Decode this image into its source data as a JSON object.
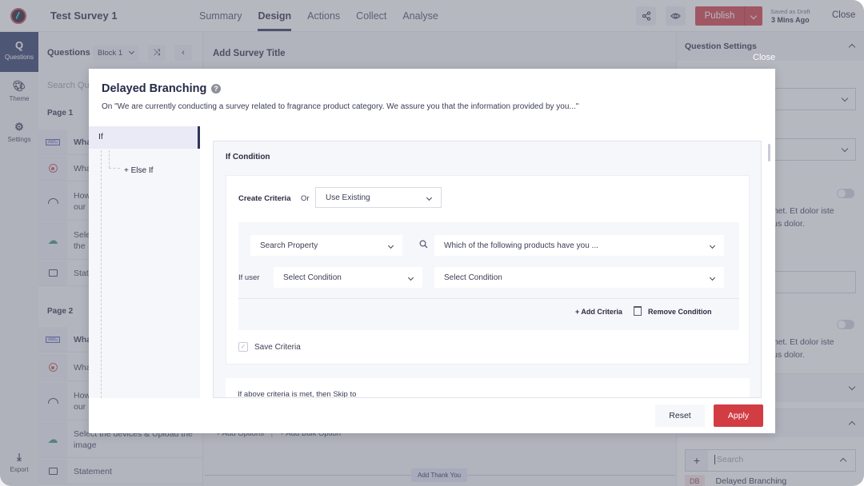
{
  "header": {
    "survey_title": "Test Survey 1",
    "tabs": [
      {
        "label": "Summary",
        "active": false
      },
      {
        "label": "Design",
        "active": true
      },
      {
        "label": "Actions",
        "active": false
      },
      {
        "label": "Collect",
        "active": false
      },
      {
        "label": "Analyse",
        "active": false
      }
    ],
    "share_icon": "share-icon",
    "preview_icon": "eye-icon",
    "publish_label": "Publish",
    "saved_status": "Saved as Draft",
    "saved_time": "3 Mins Ago",
    "close_label": "Close"
  },
  "left_nav": {
    "items": [
      {
        "label": "Questions",
        "icon": "Q",
        "active": true
      },
      {
        "label": "Theme",
        "icon": "palette-icon",
        "active": false
      },
      {
        "label": "Settings",
        "icon": "gear-icon",
        "active": false
      },
      {
        "label": "Export",
        "icon": "download-icon",
        "active": false
      }
    ]
  },
  "questions_panel": {
    "title": "Questions",
    "block_selector": "Block 1",
    "search_placeholder": "Search Qu",
    "pages": [
      {
        "label": "Page 1",
        "items": [
          {
            "type": "text-input",
            "text": "Wha"
          },
          {
            "type": "radio",
            "text": "Wha"
          },
          {
            "type": "rating",
            "text": "How\nour"
          },
          {
            "type": "upload",
            "text": "Sele\nthe"
          },
          {
            "type": "statement",
            "text": "Stat"
          }
        ]
      },
      {
        "label": "Page 2",
        "items": [
          {
            "type": "text-input",
            "text": "Wha"
          },
          {
            "type": "radio",
            "text": "Wha"
          },
          {
            "type": "rating",
            "text": "How\nour"
          },
          {
            "type": "upload",
            "text": "Select the devices & Upload the image"
          },
          {
            "type": "statement",
            "text": "Statement"
          }
        ]
      }
    ]
  },
  "canvas": {
    "title": "Add Survey Title",
    "add_options": "+ Add Options",
    "add_bulk_option": "+ Add Bulk Option",
    "add_thank_you": "Add Thank You"
  },
  "settings_panel": {
    "title": "Question Settings",
    "lorem_1a": "amet. Et dolor iste",
    "lorem_1b": "ctus dolor.",
    "lorem_2a": "amet. Et dolor iste",
    "lorem_2b": "ctus dolor.",
    "search_placeholder": "Search",
    "list_badge": "DB",
    "list_item": "Delayed Branching"
  },
  "overlay": {
    "close_label": "Close"
  },
  "modal": {
    "title": "Delayed Branching",
    "subtitle": "On \"We are currently conducting a survey related to fragrance product category. We assure you that the information provided by you...\"",
    "branches": {
      "if_label": "If",
      "else_if_label": "+ Else If"
    },
    "condition": {
      "title": "If Condition",
      "create_criteria_label": "Create Criteria",
      "or_label": "Or",
      "use_existing": "Use Existing",
      "search_property": "Search Property",
      "question_select": "Which of the following products have you ...",
      "if_user_label": "If user",
      "condition_select_1": "Select Condition",
      "condition_select_2": "Select Condition",
      "add_criteria": "+ Add Criteria",
      "remove_condition": "Remove Condition",
      "save_criteria_label": "Save Criteria",
      "save_criteria_checked": false,
      "skip_label": "If above criteria is met, then Skip to"
    },
    "footer": {
      "reset_label": "Reset",
      "apply_label": "Apply"
    }
  },
  "colors": {
    "primary_dark": "#2f3a69",
    "accent_red": "#d23d44"
  }
}
